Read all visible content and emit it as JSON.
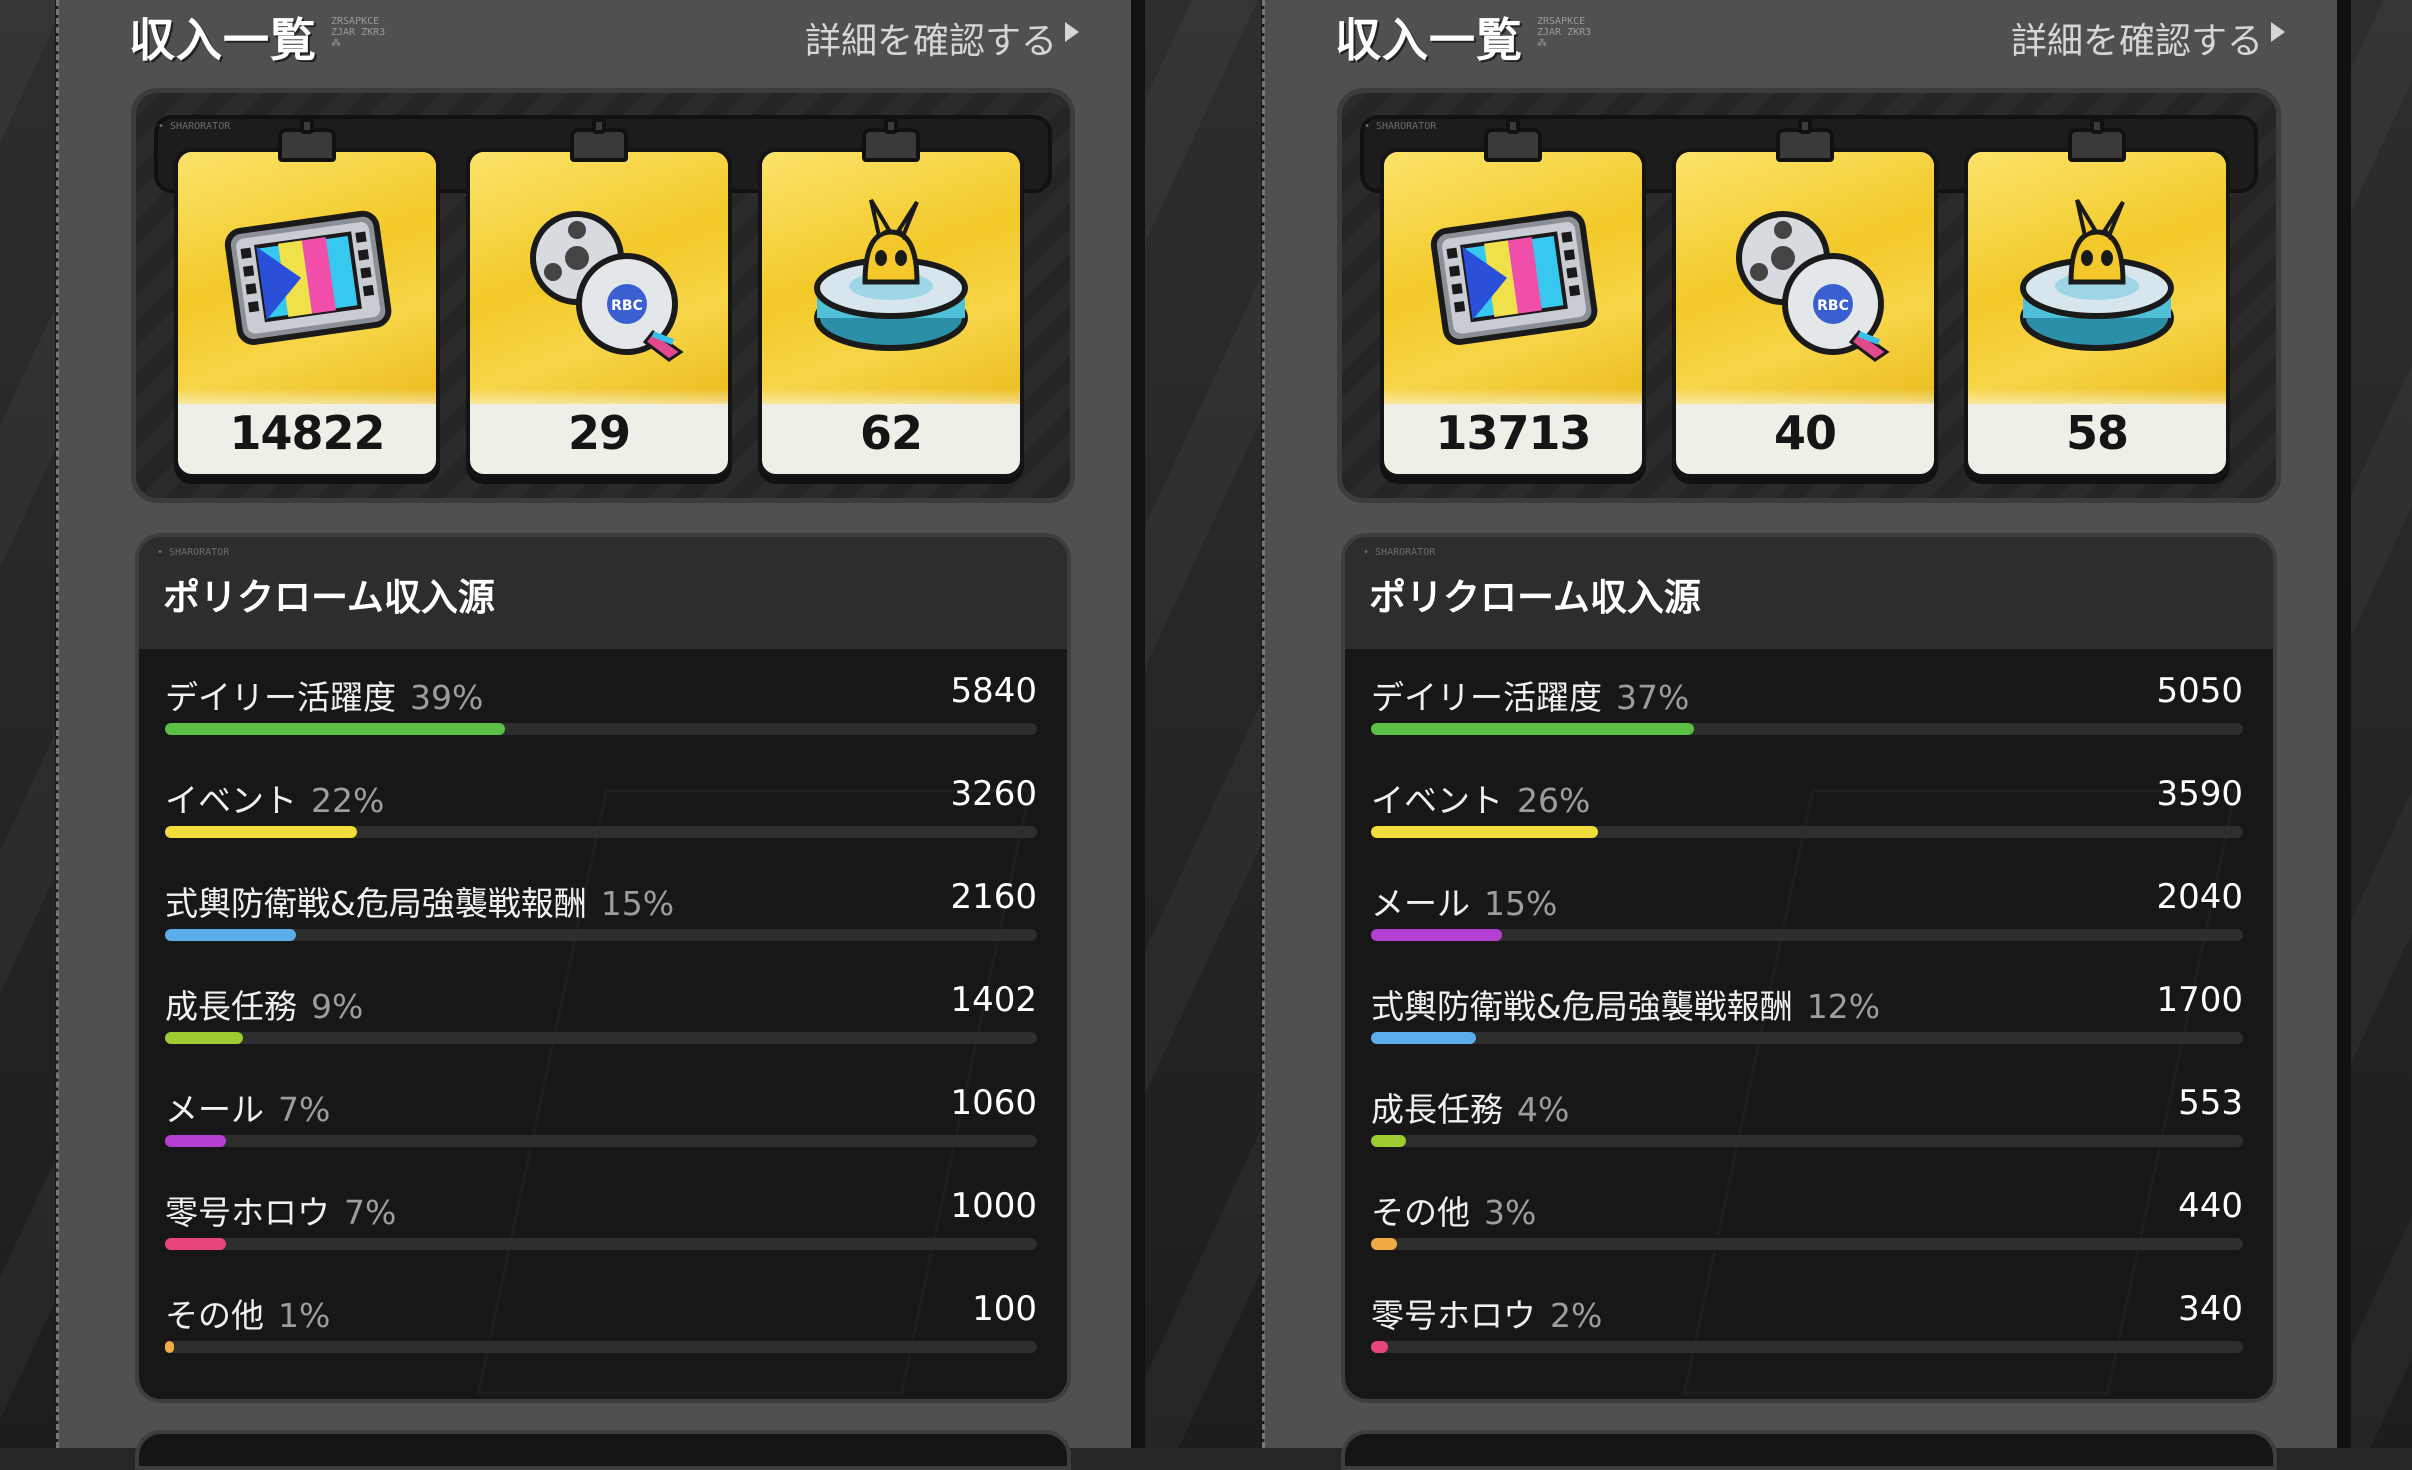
{
  "panels": [
    {
      "header": {
        "title": "収入一覧",
        "title_deco": "ZRSAPKCE ZJAR ZKR3 ⁂",
        "detail_link": "詳細を確認する"
      },
      "panel_tag": "• SHARORATOR",
      "rewards": [
        {
          "icon": "film-frame-icon",
          "count": "14822"
        },
        {
          "icon": "film-reels-icon",
          "count": "29"
        },
        {
          "icon": "bangboo-platform-icon",
          "count": "62"
        }
      ],
      "source_tag": "• SHARORATOR",
      "source_title": "ポリクローム収入源",
      "sources": [
        {
          "name": "デイリー活躍度",
          "pct": "39%",
          "amount": "5840",
          "ratio": 0.39,
          "color": "#5bbf45"
        },
        {
          "name": "イベント",
          "pct": "22%",
          "amount": "3260",
          "ratio": 0.22,
          "color": "#f0dc3a"
        },
        {
          "name": "式輿防衛戦&危局強襲戦報酬",
          "pct": "15%",
          "amount": "2160",
          "ratio": 0.15,
          "color": "#5aaee9"
        },
        {
          "name": "成長任務",
          "pct": "9%",
          "amount": "1402",
          "ratio": 0.09,
          "color": "#9ccc32"
        },
        {
          "name": "メール",
          "pct": "7%",
          "amount": "1060",
          "ratio": 0.07,
          "color": "#b43fd1"
        },
        {
          "name": "零号ホロウ",
          "pct": "7%",
          "amount": "1000",
          "ratio": 0.07,
          "color": "#e8457a"
        },
        {
          "name": "その他",
          "pct": "1%",
          "amount": "100",
          "ratio": 0.01,
          "color": "#efac44"
        }
      ]
    },
    {
      "header": {
        "title": "収入一覧",
        "title_deco": "ZRSAPKCE ZJAR ZKR3 ⁂",
        "detail_link": "詳細を確認する"
      },
      "panel_tag": "• SHARORATOR",
      "rewards": [
        {
          "icon": "film-frame-icon",
          "count": "13713"
        },
        {
          "icon": "film-reels-icon",
          "count": "40"
        },
        {
          "icon": "bangboo-platform-icon",
          "count": "58"
        }
      ],
      "source_tag": "• SHARORATOR",
      "source_title": "ポリクローム収入源",
      "sources": [
        {
          "name": "デイリー活躍度",
          "pct": "37%",
          "amount": "5050",
          "ratio": 0.37,
          "color": "#5bbf45"
        },
        {
          "name": "イベント",
          "pct": "26%",
          "amount": "3590",
          "ratio": 0.26,
          "color": "#f0dc3a"
        },
        {
          "name": "メール",
          "pct": "15%",
          "amount": "2040",
          "ratio": 0.15,
          "color": "#b43fd1"
        },
        {
          "name": "式輿防衛戦&危局強襲戦報酬",
          "pct": "12%",
          "amount": "1700",
          "ratio": 0.12,
          "color": "#5aaee9"
        },
        {
          "name": "成長任務",
          "pct": "4%",
          "amount": "553",
          "ratio": 0.04,
          "color": "#9ccc32"
        },
        {
          "name": "その他",
          "pct": "3%",
          "amount": "440",
          "ratio": 0.03,
          "color": "#efac44"
        },
        {
          "name": "零号ホロウ",
          "pct": "2%",
          "amount": "340",
          "ratio": 0.02,
          "color": "#e8457a"
        }
      ]
    }
  ]
}
